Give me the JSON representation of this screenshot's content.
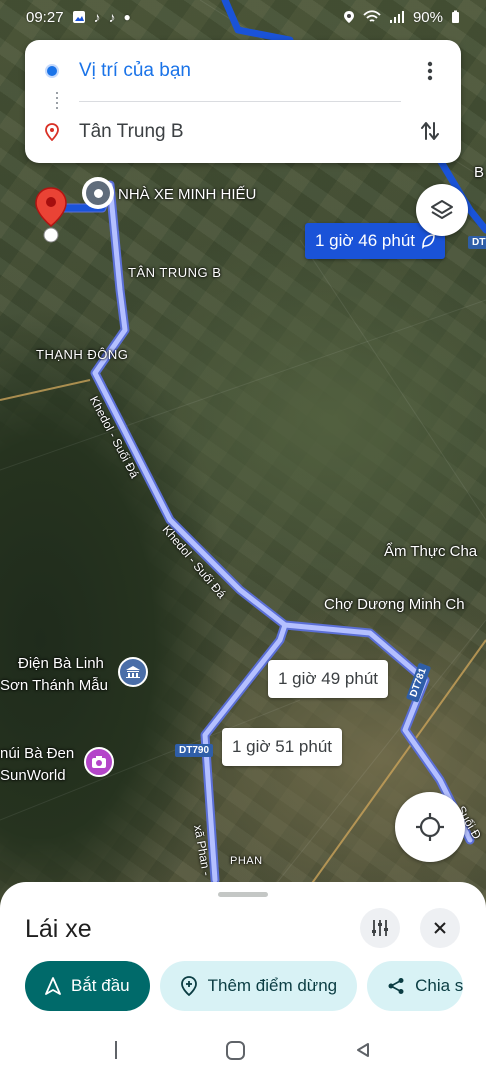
{
  "status_bar": {
    "time": "09:27",
    "battery": "90%",
    "notification_icons": [
      "image-icon",
      "tiktok-icon",
      "tiktok-icon",
      "dot-icon"
    ],
    "system_icons": [
      "location-icon",
      "wifi-icon",
      "signal-icon",
      "battery-icon"
    ]
  },
  "search": {
    "origin": "Vị trí của bạn",
    "destination": "Tân Trung B"
  },
  "map": {
    "labels": {
      "nha_xe": "NHÀ XE MINH HIẾU",
      "tan_trung_b": "TÂN TRUNG B",
      "thanh_dong": "THẠNH ĐÔNG",
      "am_thuc": "Ẩm Thực Cha",
      "cho_duong": "Chợ Dương Minh Ch",
      "dien_ba_linh_1": "Điện Bà Linh",
      "dien_ba_linh_2": "Sơn Thánh Mẫu",
      "nui_ba_den_1": "núi Bà Đen",
      "nui_ba_den_2": "SunWorld",
      "phan": "PHAN",
      "b_edge": "B"
    },
    "roads": {
      "khedol_1": "Khedol - Suối Đá",
      "khedol_2": "Khedol - Suối Đá",
      "xa_phan": "xã Phan -",
      "suoi_da_edge": "Suối Đ",
      "dt790": "DT790",
      "dt781": "DT781",
      "dt7_edge": "DT7"
    },
    "routes": {
      "primary": "1 giờ 46 phút",
      "alt1": "1 giờ 49 phút",
      "alt2": "1 giờ 51 phút"
    },
    "colors": {
      "primary_route": "#1a53d8",
      "alt_route": "#aab8ff",
      "pin": "#ea4335"
    }
  },
  "sheet": {
    "title": "Lái xe",
    "buttons": {
      "start": "Bắt đầu",
      "add_stop": "Thêm điểm dừng",
      "share": "Chia s"
    },
    "colors": {
      "start_bg": "#006a6a",
      "chip_bg": "#d8f2f5"
    }
  },
  "nav_bar": {
    "icons": [
      "recents-icon",
      "home-icon",
      "back-icon"
    ]
  }
}
